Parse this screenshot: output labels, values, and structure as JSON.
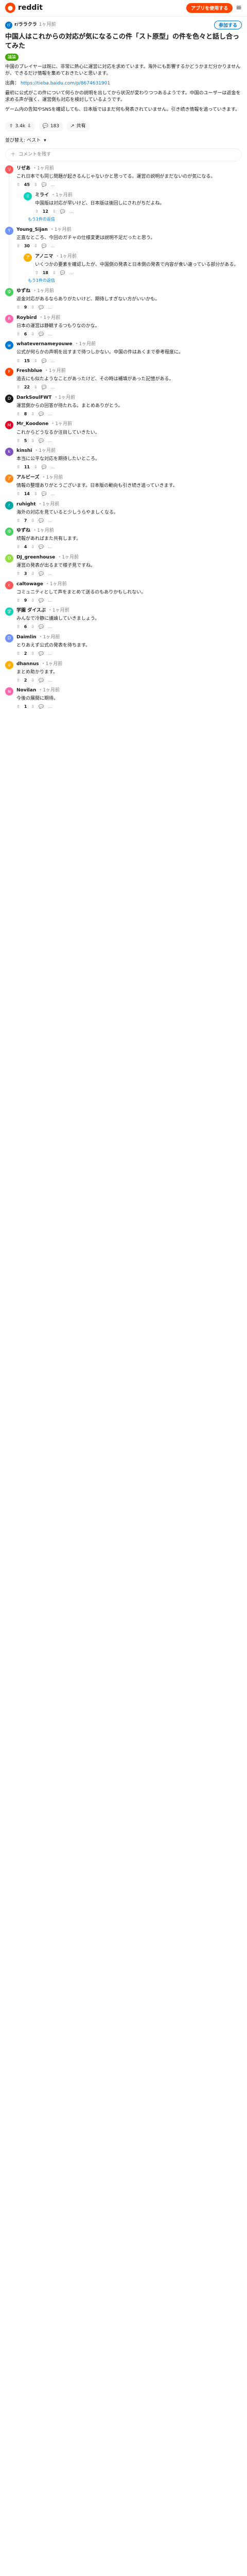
{
  "topbar": {
    "brand": "reddit",
    "open_app": "アプリを使用する",
    "menu_glyph": "≡"
  },
  "post": {
    "subreddit": "r/ララクラ",
    "age": "1ヶ月前",
    "join_label": "参加する",
    "title": "中国人はこれからの対応が気になるこの件「スト原型」の件を色々と話し合ってみた",
    "flair": "議論",
    "body": [
      "中国のプレイヤーは既に、非常に熱心に運営に対応を求めています。海外にも影響するかどうかまだ分かりませんが、できるだけ情報を集めておきたいと思います。",
      "出典：",
      "最初に公式がこの件について何らかの説明を出してから状況が変わりつつあるようです。中国のユーザーは返金を求める声が強く、運営側も対応を検討しているようです。",
      "ゲーム内の告知やSNSを確認しても、日本版ではまだ何も発表されていません。引き続き情報を追っていきます。"
    ],
    "link": "https://tieba.baidu.com/p/8674631901",
    "votes": "3.4k",
    "comments_count": "183",
    "share_label": "共有"
  },
  "sort": {
    "label": "並び替え: ベスト",
    "add_comment": "コメントを残す"
  },
  "comments": [
    {
      "author": "リゼあ",
      "age": "1ヶ月前",
      "avatar_color": "#ff585b",
      "body": "これ日本でも同じ問題が起きるんじゃないかと思ってる。運営の説明がまだないのが気になる。",
      "score": "45",
      "replies": [
        {
          "author": "ミライ",
          "age": "1ヶ月前",
          "avatar_color": "#0dd3bb",
          "body": "中国版は対応が早いけど、日本版は後回しにされがちだよね。",
          "score": "12"
        }
      ]
    },
    {
      "author": "Young_Sijan",
      "age": "1ヶ月前",
      "avatar_color": "#7193ff",
      "body": "正直なところ、今回のガチャの仕様変更は説明不足だったと思う。",
      "score": "30",
      "replies": [
        {
          "author": "アノニマ",
          "age": "1ヶ月前",
          "avatar_color": "#ffb000",
          "body": "いくつかの要素を確認したが、中国側の発表と日本側の発表で内容が食い違っている部分がある。",
          "score": "18"
        }
      ]
    },
    {
      "author": "ゆずね",
      "age": "1ヶ月前",
      "avatar_color": "#46d160",
      "body": "返金対応があるならありがたいけど、期待しすぎない方がいいかも。",
      "score": "9",
      "replies": []
    },
    {
      "author": "Roybird",
      "age": "1ヶ月前",
      "avatar_color": "#ff66ac",
      "body": "日本の運営は静観するつもりなのかな。",
      "score": "6",
      "replies": []
    },
    {
      "author": "whatevernameyouwe",
      "age": "1ヶ月前",
      "avatar_color": "#0079d3",
      "body": "公式が何らかの声明を出すまで待つしかない。中国の件はあくまで参考程度に。",
      "score": "15",
      "replies": []
    },
    {
      "author": "Freshblue",
      "age": "1ヶ月前",
      "avatar_color": "#ff4500",
      "body": "過去にも似たようなことがあったけど、その時は補填があった記憶がある。",
      "score": "22",
      "replies": []
    },
    {
      "author": "DarkSoulFWT",
      "age": "1ヶ月前",
      "avatar_color": "#1a1a1b",
      "body": "運営側からの回答が待たれる。まとめありがとう。",
      "score": "8",
      "replies": []
    },
    {
      "author": "Mr_Koodone",
      "age": "1ヶ月前",
      "avatar_color": "#ea0027",
      "body": "これからどうなるか注目していきたい。",
      "score": "5",
      "replies": []
    },
    {
      "author": "kinshi",
      "age": "1ヶ月前",
      "avatar_color": "#7e53c1",
      "body": "本当に公平な対応を期待したいところ。",
      "score": "11",
      "replies": []
    },
    {
      "author": "アルビーズ",
      "age": "1ヶ月前",
      "avatar_color": "#ff8717",
      "body": "情報の整理ありがとうございます。日本版の動向も引き続き追っていきます。",
      "score": "14",
      "replies": []
    },
    {
      "author": "ruhight",
      "age": "1ヶ月前",
      "avatar_color": "#00a6a5",
      "body": "海外の対応を見ていると少しうらやましくなる。",
      "score": "7",
      "replies": []
    },
    {
      "author": "ゆずね",
      "age": "1ヶ月前",
      "avatar_color": "#46d160",
      "body": "続報があればまた共有します。",
      "score": "4",
      "replies": []
    },
    {
      "author": "DJ_greenhouse",
      "age": "1ヶ月前",
      "avatar_color": "#94e044",
      "body": "運営の発表が出るまで様子見ですね。",
      "score": "3",
      "replies": []
    },
    {
      "author": "caltowage",
      "age": "1ヶ月前",
      "avatar_color": "#ff585b",
      "body": "コミュニティとして声をまとめて送るのもありかもしれない。",
      "score": "9",
      "replies": []
    },
    {
      "author": "学園 ダイスぶ",
      "age": "1ヶ月前",
      "avatar_color": "#0dd3bb",
      "body": "みんなで冷静に議論していきましょう。",
      "score": "6",
      "replies": []
    },
    {
      "author": "Daimlin",
      "age": "1ヶ月前",
      "avatar_color": "#7193ff",
      "body": "とりあえず公式の発表を待ちます。",
      "score": "2",
      "replies": []
    },
    {
      "author": "dhannus",
      "age": "1ヶ月前",
      "avatar_color": "#ffb000",
      "body": "まとめ助かります。",
      "score": "2",
      "replies": []
    },
    {
      "author": "Novilan",
      "age": "1ヶ月前",
      "avatar_color": "#ff66ac",
      "body": "今後の展開に期待。",
      "score": "1",
      "replies": []
    }
  ],
  "more_replies": "もう1件の返信"
}
